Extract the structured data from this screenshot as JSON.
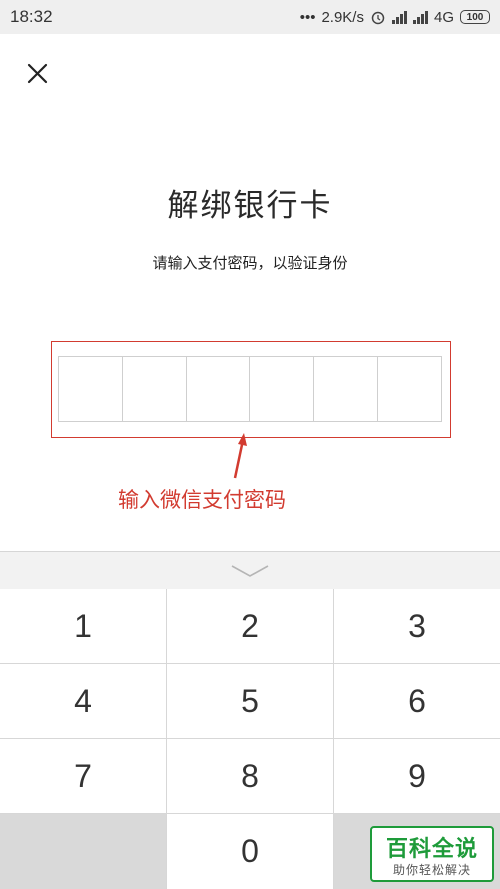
{
  "status_bar": {
    "time": "18:32",
    "speed": "2.9K/s",
    "network": "4G",
    "battery": "100"
  },
  "header": {
    "close_icon": "close-icon"
  },
  "title": "解绑银行卡",
  "subtitle": "请输入支付密码，以验证身份",
  "pin": {
    "digits": 6,
    "annotation": "输入微信支付密码",
    "highlight_color": "#d23b30"
  },
  "keypad": {
    "collapse_icon": "chevron-down-icon",
    "keys": [
      "1",
      "2",
      "3",
      "4",
      "5",
      "6",
      "7",
      "8",
      "9",
      "",
      "0",
      ""
    ]
  },
  "watermark": {
    "title": "百科全说",
    "subtitle": "助你轻松解决"
  }
}
